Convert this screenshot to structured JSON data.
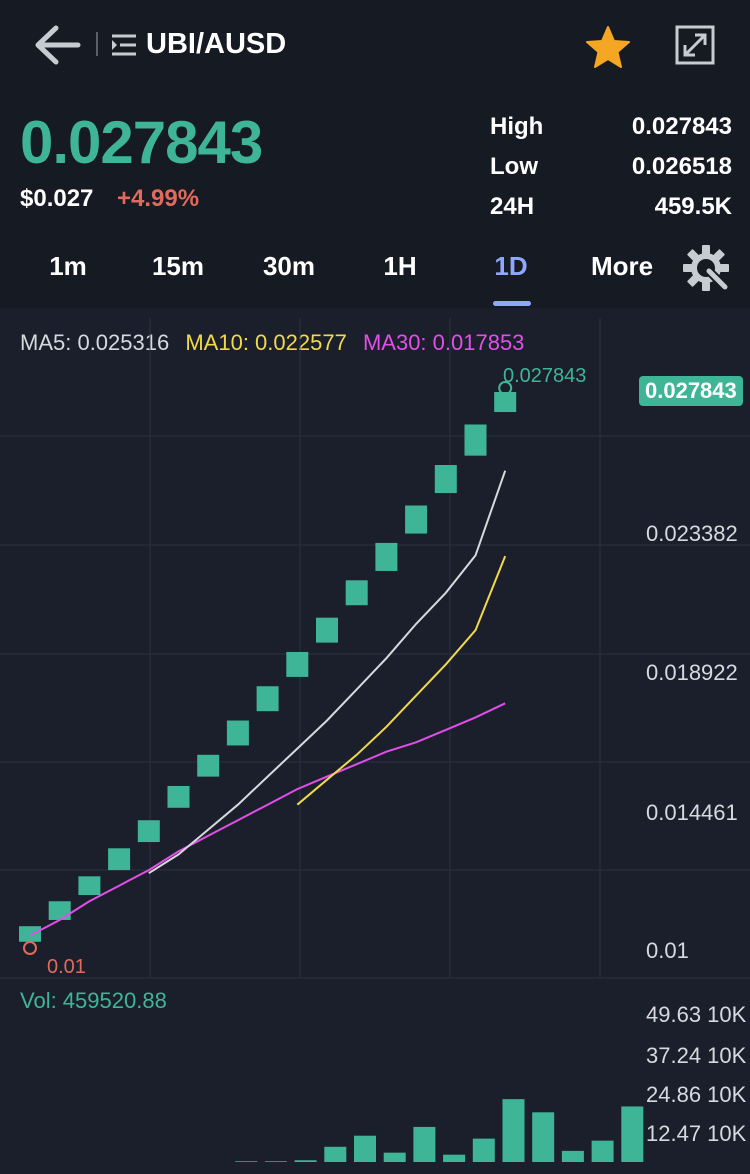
{
  "header": {
    "pair": "UBI/AUSD",
    "icons": {
      "back": "back-arrow-icon",
      "pair_menu": "pair-list-icon",
      "favorite": "star-icon",
      "fullscreen": "fullscreen-icon"
    },
    "favorite_color": "#f5a623"
  },
  "ticker": {
    "last_price": "0.027843",
    "fiat_price": "$0.027",
    "change": "+4.99%",
    "stats": [
      {
        "label": "High",
        "value": "0.027843"
      },
      {
        "label": "Low",
        "value": "0.026518"
      },
      {
        "label": "24H",
        "value": "459.5K"
      }
    ]
  },
  "intervals": {
    "tabs": [
      {
        "label": "1m",
        "active": false
      },
      {
        "label": "15m",
        "active": false
      },
      {
        "label": "30m",
        "active": false
      },
      {
        "label": "1H",
        "active": false
      },
      {
        "label": "1D",
        "active": true
      },
      {
        "label": "More",
        "active": false
      }
    ],
    "settings_icon": "settings-gear-icon"
  },
  "indicators": {
    "ma5": "MA5: 0.025316",
    "ma10": "MA10: 0.022577",
    "ma30": "MA30: 0.017853"
  },
  "colors": {
    "up": "#3fb597",
    "down": "#e26a5c",
    "ma5": "#d7d9de",
    "ma10": "#f0d94a",
    "ma30": "#e14fe8",
    "accent": "#8fa8ff"
  },
  "chart_data": {
    "type": "candlestick",
    "y_ticks": [
      "0.027843",
      "0.023382",
      "0.018922",
      "0.014461",
      "0.01"
    ],
    "ylim": [
      0.008,
      0.0285
    ],
    "last_price_tag": "0.027843",
    "max_annotation": "0.027843",
    "min_annotation": "0.01",
    "candles": [
      {
        "open": 0.0102,
        "close": 0.0107
      },
      {
        "open": 0.0109,
        "close": 0.0115
      },
      {
        "open": 0.0117,
        "close": 0.0123
      },
      {
        "open": 0.0125,
        "close": 0.0132
      },
      {
        "open": 0.0134,
        "close": 0.0141
      },
      {
        "open": 0.0145,
        "close": 0.0152
      },
      {
        "open": 0.0155,
        "close": 0.0162
      },
      {
        "open": 0.0165,
        "close": 0.0173
      },
      {
        "open": 0.0176,
        "close": 0.0184
      },
      {
        "open": 0.0187,
        "close": 0.0195
      },
      {
        "open": 0.0198,
        "close": 0.0206
      },
      {
        "open": 0.021,
        "close": 0.0218
      },
      {
        "open": 0.0221,
        "close": 0.023
      },
      {
        "open": 0.0233,
        "close": 0.0242
      },
      {
        "open": 0.0246,
        "close": 0.0255
      },
      {
        "open": 0.0258,
        "close": 0.0268
      },
      {
        "open": 0.0272,
        "close": 0.027843
      }
    ],
    "ma5": [
      null,
      null,
      null,
      null,
      0.0124,
      0.013,
      0.0138,
      0.0146,
      0.0155,
      0.0164,
      0.0173,
      0.0183,
      0.0193,
      0.0204,
      0.0214,
      0.0226,
      0.025316
    ],
    "ma10": [
      null,
      null,
      null,
      null,
      null,
      null,
      null,
      null,
      null,
      0.0146,
      0.0154,
      0.0162,
      0.0171,
      0.0181,
      0.0191,
      0.0202,
      0.022577
    ],
    "ma30": [
      0.0104,
      0.0109,
      0.0115,
      0.012,
      0.0125,
      0.0131,
      0.0136,
      0.0141,
      0.0146,
      0.0151,
      0.0155,
      0.0159,
      0.0163,
      0.0166,
      0.017,
      0.0174,
      0.017853
    ],
    "volume": {
      "label": "Vol: 459520.88",
      "ticks": [
        "49.63 10K",
        "37.24 10K",
        "24.86 10K",
        "12.47 10K"
      ],
      "ymax": 52,
      "values": [
        0,
        0,
        0,
        0,
        0,
        0,
        0.25,
        0.25,
        0.6,
        5.2,
        9.0,
        3.2,
        12.0,
        2.5,
        8.0,
        21.5,
        17.0,
        3.8,
        7.3,
        19.0
      ]
    }
  }
}
